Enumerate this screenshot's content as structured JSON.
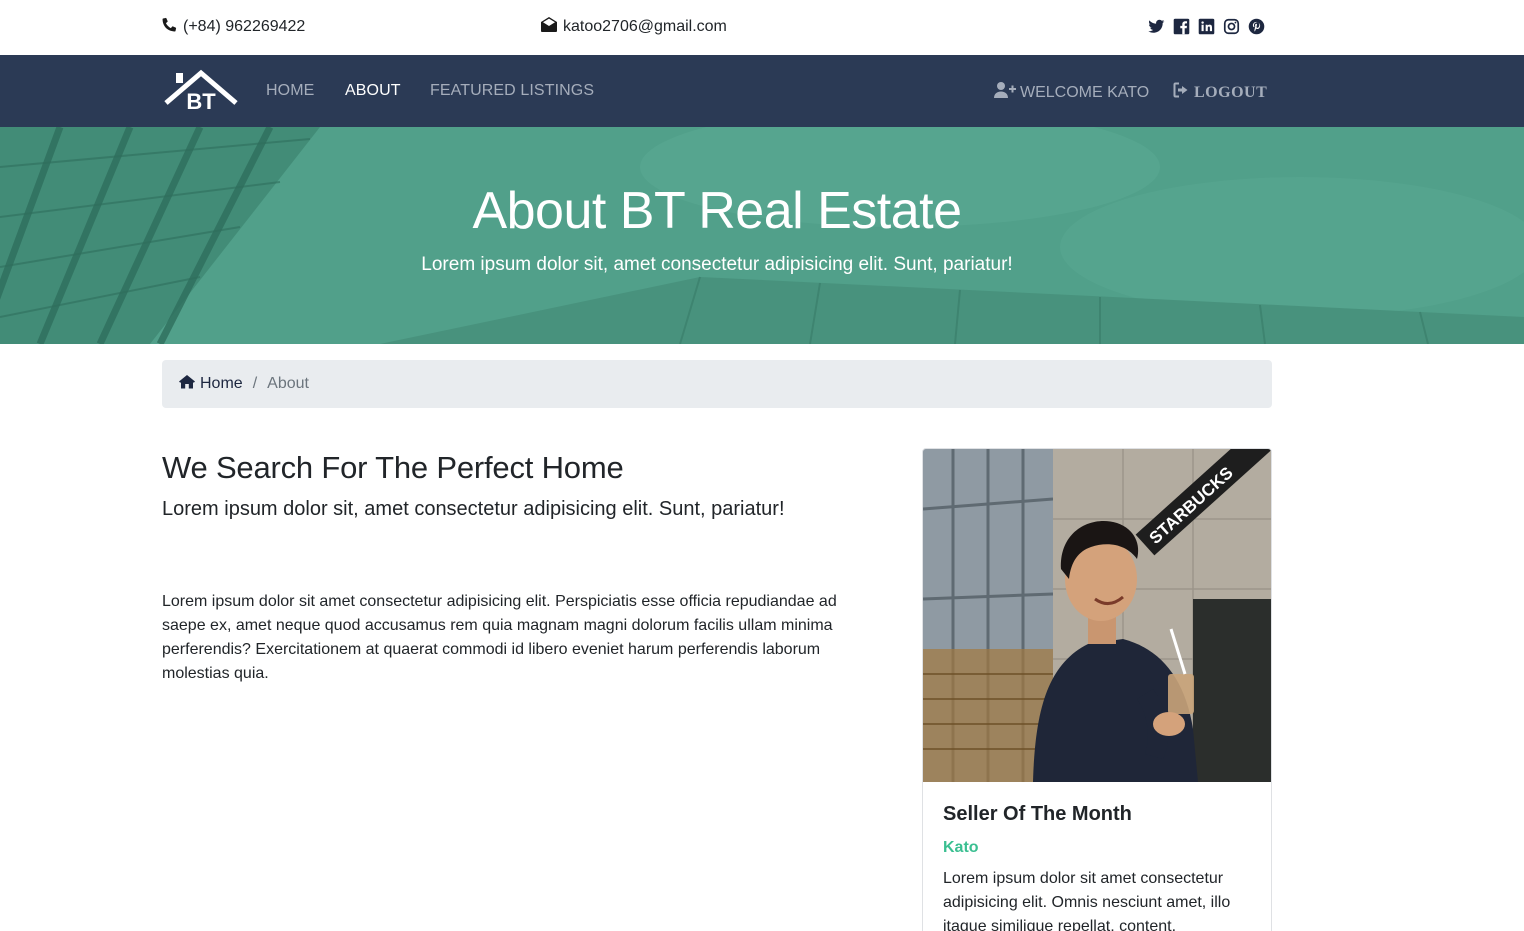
{
  "topbar": {
    "phone": "(+84) 962269422",
    "email": "katoo2706@gmail.com",
    "social": [
      "twitter-icon",
      "facebook-icon",
      "linkedin-icon",
      "instagram-icon",
      "pinterest-icon"
    ]
  },
  "navbar": {
    "logo_text": "BT",
    "links": [
      {
        "label": "HOME",
        "active": false
      },
      {
        "label": "ABOUT",
        "active": true
      },
      {
        "label": "FEATURED LISTINGS",
        "active": false
      }
    ],
    "welcome": "WELCOME KATO",
    "logout": "LOGOUT",
    "background": "#2b3a55"
  },
  "hero": {
    "title": "About BT Real Estate",
    "subtitle": "Lorem ipsum dolor sit, amet consectetur adipisicing elit. Sunt, pariatur!",
    "overlay_color": "#4e9a84"
  },
  "breadcrumb": {
    "home": "Home",
    "current": "About"
  },
  "main": {
    "heading": "We Search For The Perfect Home",
    "lead": "Lorem ipsum dolor sit, amet consectetur adipisicing elit. Sunt, pariatur!",
    "body": "Lorem ipsum dolor sit amet consectetur adipisicing elit. Perspiciatis esse officia repudiandae ad saepe ex, amet neque quod accusamus rem quia magnam magni dolorum facilis ullam minima perferendis? Exercitationem at quaerat commodi id libero eveniet harum perferendis laborum molestias quia."
  },
  "card": {
    "photo_sign": "STARBUCKS",
    "title": "Seller Of The Month",
    "name": "Kato",
    "text": "Lorem ipsum dolor sit amet consectetur adipisicing elit. Omnis nesciunt amet, illo itaque similique repellat, content.",
    "accent_color": "#3bbf91"
  }
}
